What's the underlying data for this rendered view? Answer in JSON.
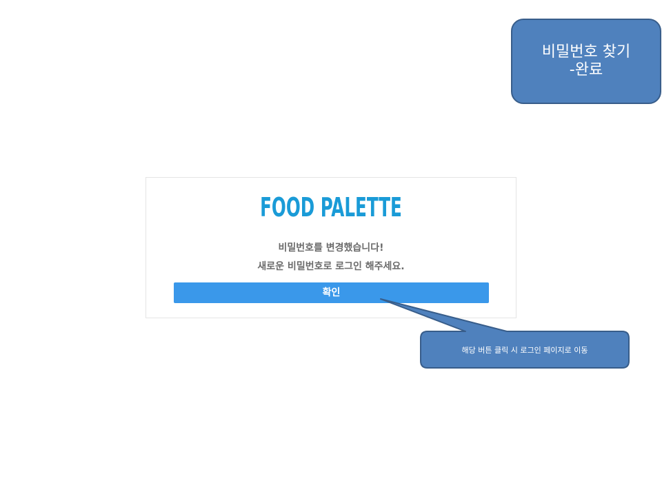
{
  "slide": {
    "title_line1": "비밀번호 찾기",
    "title_line2": "-완료"
  },
  "card": {
    "logo": "FOOD PALETTE",
    "message_line1": "비밀번호를 변경했습니다!",
    "message_line2": "새로운 비밀번호로 로그인 해주세요.",
    "confirm_label": "확인"
  },
  "annotation": {
    "text": "해당 버튼 클릭 시 로그인 페이지로 이동"
  },
  "colors": {
    "title_box_fill": "#4f81bd",
    "title_box_border": "#385d8a",
    "logo": "#1a9bd7",
    "button": "#3a98ea",
    "message_text": "#6b6b6b"
  }
}
